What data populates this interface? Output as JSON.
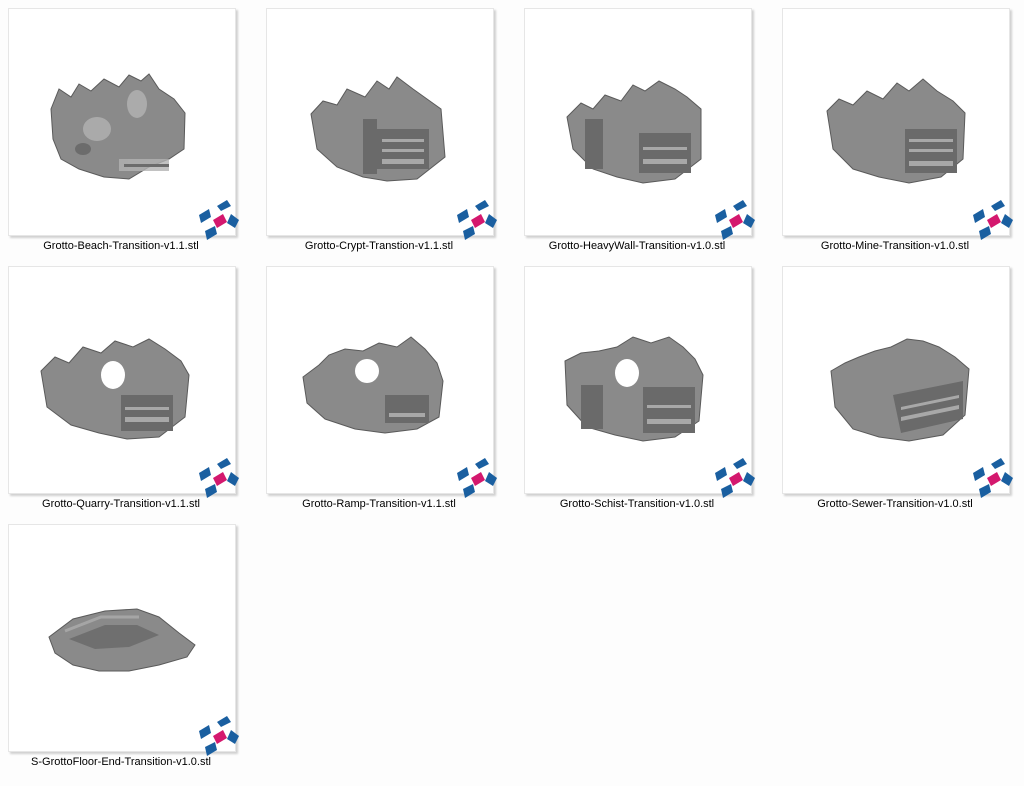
{
  "files": [
    {
      "name": "Grotto-Beach-Transition-v1.1.stl",
      "thumbnail": "cave-tile-beach",
      "icon": "stl-file-badge-icon"
    },
    {
      "name": "Grotto-Crypt-Transtion-v1.1.stl",
      "thumbnail": "cave-tile-crypt",
      "icon": "stl-file-badge-icon"
    },
    {
      "name": "Grotto-HeavyWall-Transition-v1.0.stl",
      "thumbnail": "cave-tile-heavywall",
      "icon": "stl-file-badge-icon"
    },
    {
      "name": "Grotto-Mine-Transition-v1.0.stl",
      "thumbnail": "cave-tile-mine",
      "icon": "stl-file-badge-icon"
    },
    {
      "name": "Grotto-Quarry-Transition-v1.1.stl",
      "thumbnail": "cave-tile-quarry",
      "icon": "stl-file-badge-icon"
    },
    {
      "name": "Grotto-Ramp-Transition-v1.1.stl",
      "thumbnail": "cave-tile-ramp",
      "icon": "stl-file-badge-icon"
    },
    {
      "name": "Grotto-Schist-Transition-v1.0.stl",
      "thumbnail": "cave-tile-schist",
      "icon": "stl-file-badge-icon"
    },
    {
      "name": "Grotto-Sewer-Transition-v1.0.stl",
      "thumbnail": "cave-tile-sewer",
      "icon": "stl-file-badge-icon"
    },
    {
      "name": "S-GrottoFloor-End-Transition-v1.0.stl",
      "thumbnail": "cave-floor-flat",
      "icon": "stl-file-badge-icon"
    }
  ],
  "colors": {
    "badge_blue": "#1a5fa0",
    "badge_magenta": "#d4186e",
    "model_gray": "#8e8e8e"
  }
}
